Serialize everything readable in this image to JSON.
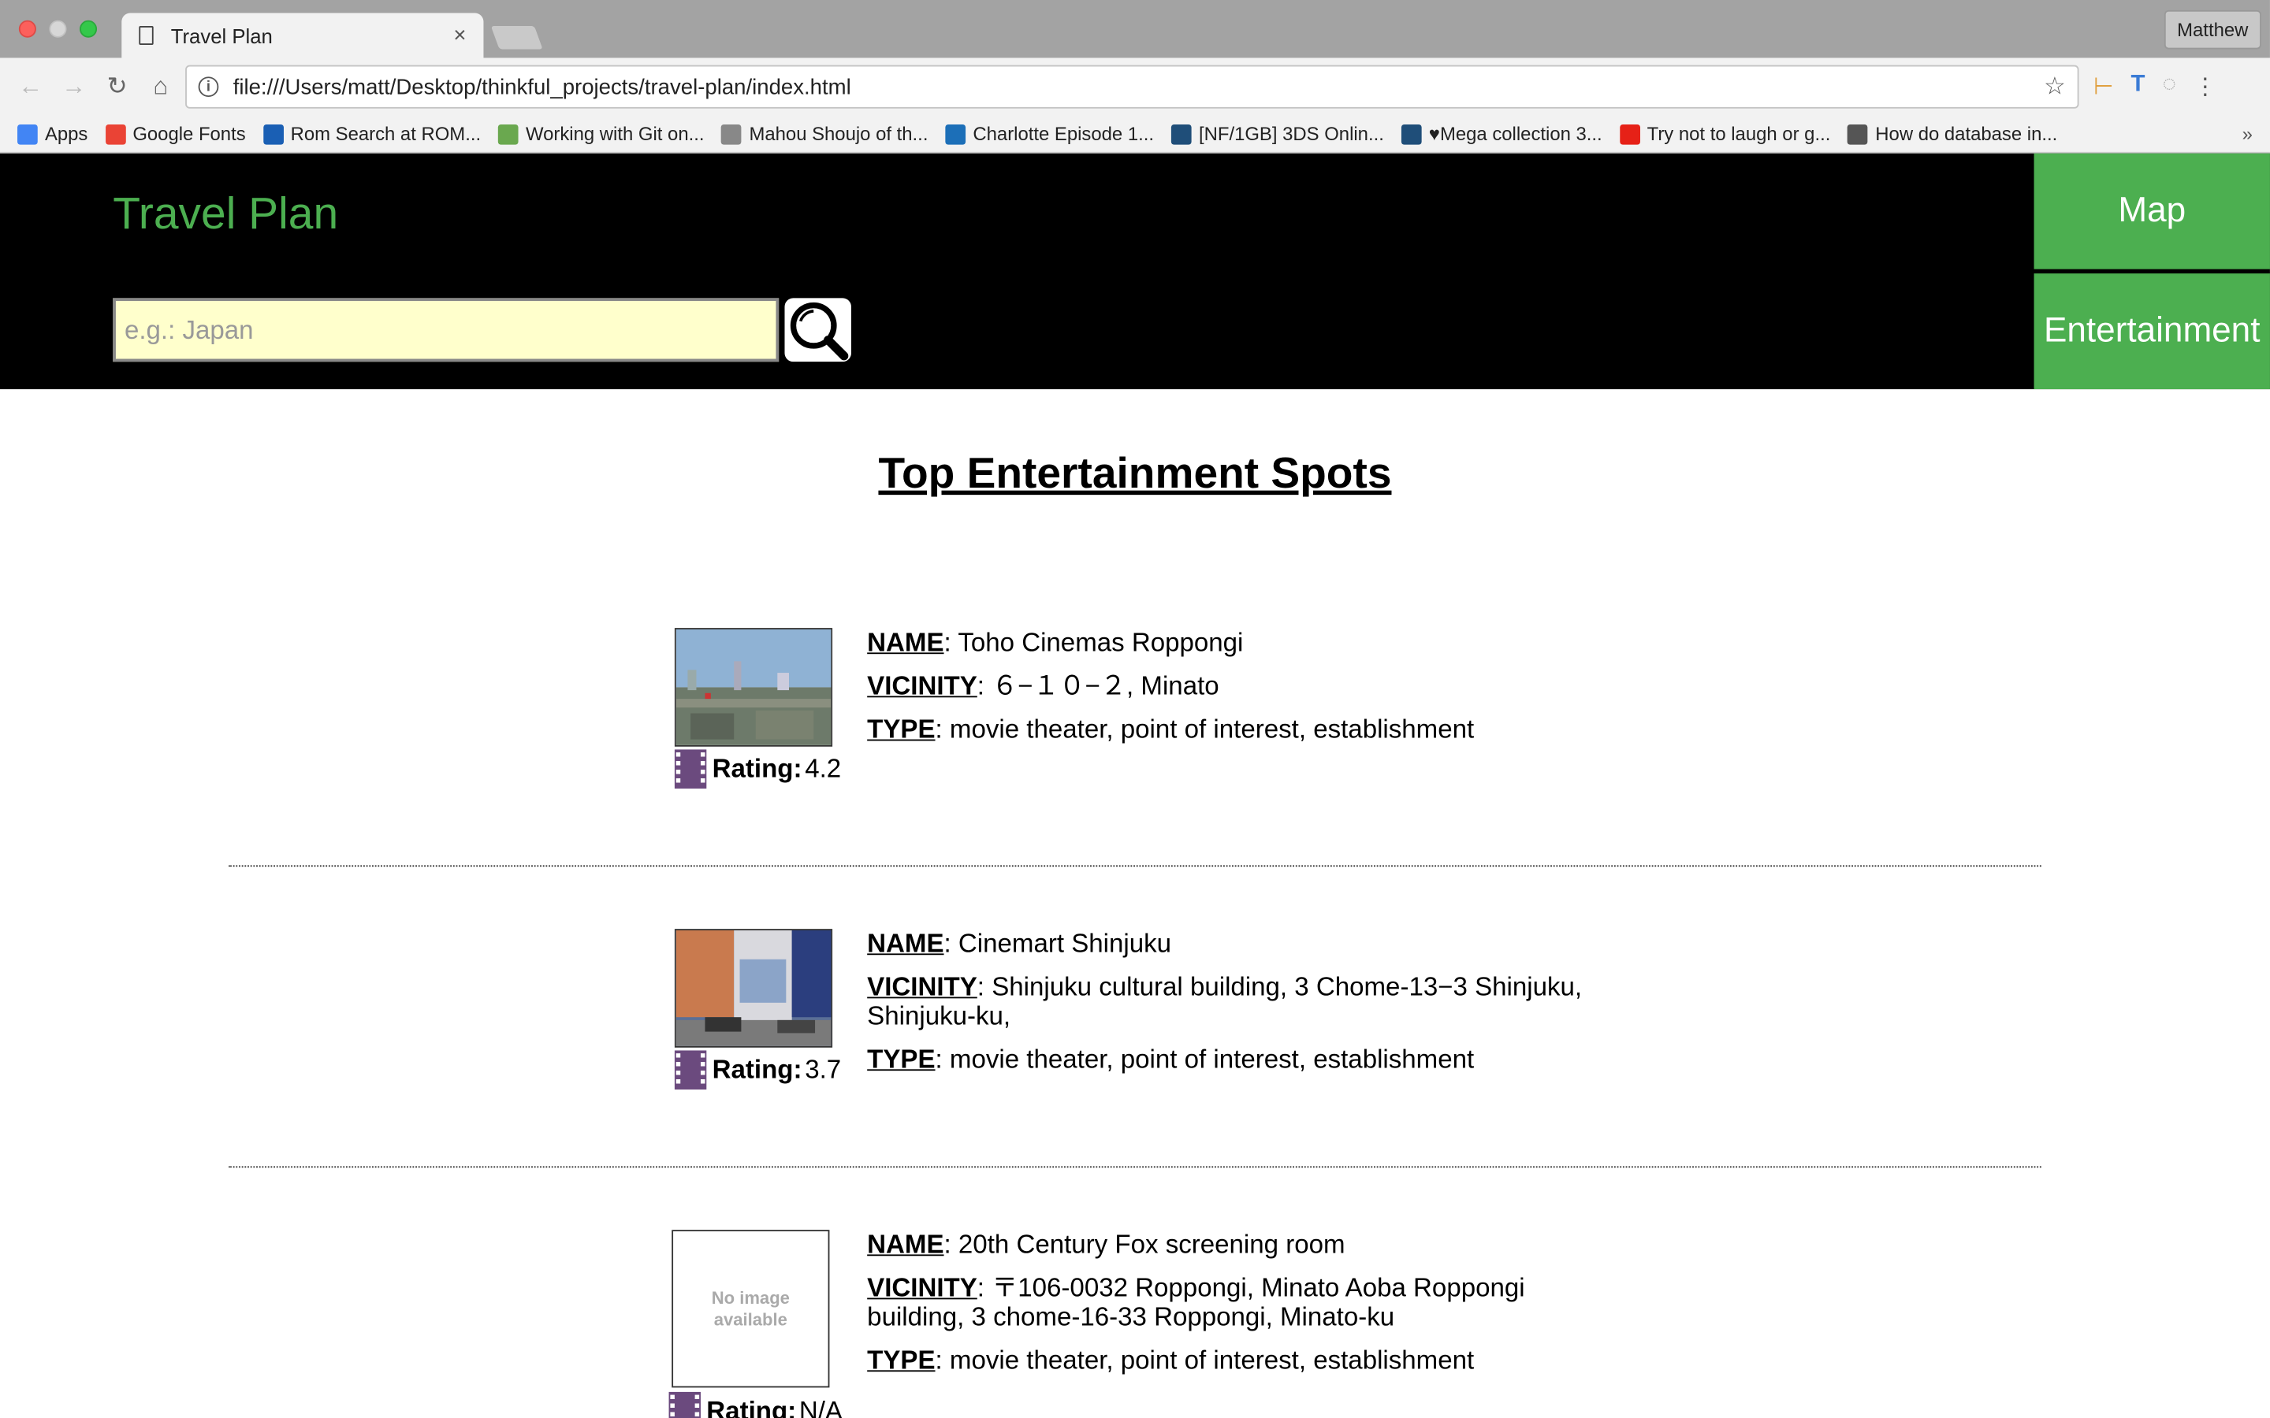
{
  "browser": {
    "tab_title": "Travel Plan",
    "tab_close": "×",
    "profile_name": "Matthew",
    "url": "file:///Users/matt/Desktop/thinkful_projects/travel-plan/index.html",
    "bookmarks": [
      {
        "label": "Apps",
        "color": "#4285f4"
      },
      {
        "label": "Google Fonts",
        "color": "#ea4335"
      },
      {
        "label": "Rom Search at ROM...",
        "color": "#1a5fb4"
      },
      {
        "label": "Working with Git on...",
        "color": "#6aa84f"
      },
      {
        "label": "Mahou Shoujo of th...",
        "color": "#888888"
      },
      {
        "label": "Charlotte Episode 1...",
        "color": "#1c6fb8"
      },
      {
        "label": "[NF/1GB] 3DS Onlin...",
        "color": "#1f4e79"
      },
      {
        "label": "♥Mega collection 3...",
        "color": "#1f4e79"
      },
      {
        "label": "Try not to laugh or g...",
        "color": "#e62117"
      },
      {
        "label": "How do database in...",
        "color": "#555555"
      }
    ],
    "bookmarks_more": "»"
  },
  "header": {
    "title": "Travel Plan",
    "search_placeholder": "e.g.: Japan",
    "nav": {
      "map": "Map",
      "entertainment": "Entertainment"
    },
    "accent_color": "#4caf50"
  },
  "main": {
    "title": "Top Entertainment Spots",
    "labels": {
      "name": "NAME",
      "vicinity": "VICINITY",
      "type": "TYPE",
      "rating": "Rating:"
    },
    "no_image_text": "No image available",
    "spots": [
      {
        "name": "Toho Cinemas Roppongi",
        "vicinity": "６−１０−２, Minato",
        "type": "movie theater, point of interest, establishment",
        "rating": "4.2"
      },
      {
        "name": "Cinemart Shinjuku",
        "vicinity": "Shinjuku cultural building, 3 Chome-13−3 Shinjuku, Shinjuku-ku,",
        "type": "movie theater, point of interest, establishment",
        "rating": "3.7"
      },
      {
        "name": "20th Century Fox screening room",
        "vicinity": "〒106-0032 Roppongi, Minato Aoba Roppongi building, 3 chome-16-33 Roppongi, Minato-ku",
        "type": "movie theater, point of interest, establishment",
        "rating": "N/A"
      }
    ]
  }
}
